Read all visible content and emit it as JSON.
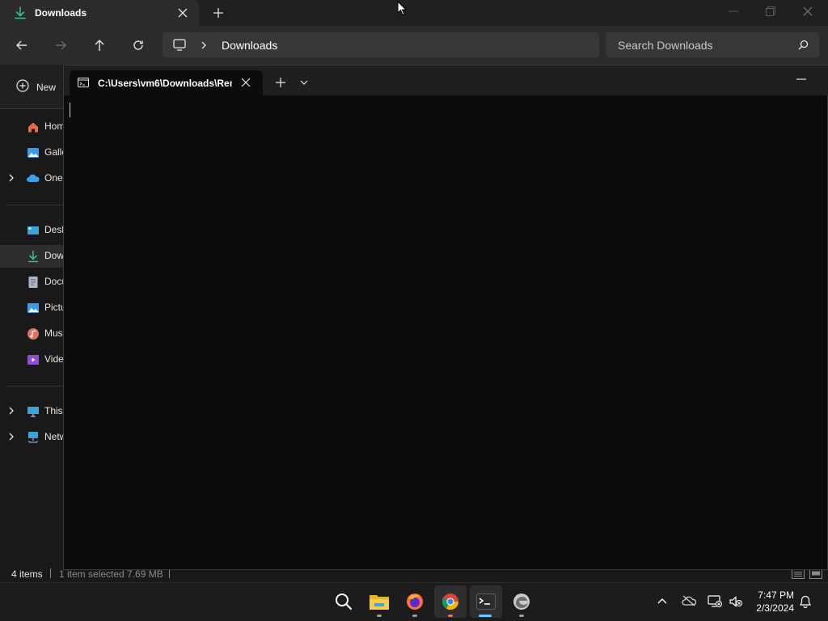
{
  "explorer": {
    "tab_title": "Downloads",
    "address": {
      "location": "Downloads"
    },
    "search": {
      "placeholder": "Search Downloads"
    },
    "new_button_label": "New",
    "sidebar": {
      "items": [
        {
          "label": "Home",
          "icon": "home-icon",
          "color": "#e8684a"
        },
        {
          "label": "Gallery",
          "icon": "gallery-icon",
          "color": "#3d9be9"
        },
        {
          "label": "OneDrive",
          "icon": "onedrive-icon",
          "color": "#3ca0e6"
        },
        {
          "label": "Desktop",
          "icon": "desktop-icon",
          "color": "#3ba3d8"
        },
        {
          "label": "Downloads",
          "icon": "download-icon",
          "color": "#3fb98b"
        },
        {
          "label": "Documents",
          "icon": "documents-icon",
          "color": "#aeb8c4"
        },
        {
          "label": "Pictures",
          "icon": "pictures-icon",
          "color": "#3d9be9"
        },
        {
          "label": "Music",
          "icon": "music-icon",
          "color": "#e2735f"
        },
        {
          "label": "Videos",
          "icon": "videos-icon",
          "color": "#8c4fd1"
        },
        {
          "label": "This PC",
          "icon": "pc-icon",
          "color": "#3ba3d8"
        },
        {
          "label": "Network",
          "icon": "network-icon",
          "color": "#3ba3d8"
        }
      ]
    },
    "status": {
      "item_count": "4 items",
      "selection": "1 item selected  7.69 MB"
    }
  },
  "terminal": {
    "tab_title": "C:\\Users\\vm6\\Downloads\\Rer"
  },
  "taskbar": {
    "apps": [
      "search-icon",
      "file-explorer-icon",
      "firefox-icon",
      "chrome-icon",
      "terminal-icon",
      "edge-icon"
    ],
    "clock": {
      "time": "7:47 PM",
      "date": "2/3/2024"
    }
  },
  "colors": {
    "accent": "#60cdff",
    "download_green": "#3fb98b",
    "terminal_bg": "#0c0c0c",
    "taskbar_bg": "#1c1c1c"
  }
}
